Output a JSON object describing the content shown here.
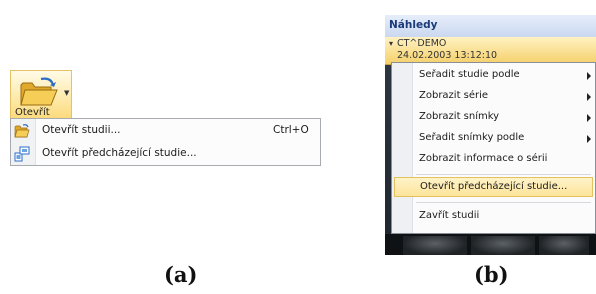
{
  "panel_a": {
    "caption": "(a)",
    "ribbon_button": {
      "label": "Otevřít",
      "icon": "open-folder-icon"
    },
    "menu": [
      {
        "label": "Otevřít studii...",
        "shortcut": "Ctrl+O",
        "icon": "open-folder-icon"
      },
      {
        "label": "Otevřít předcházející studie...",
        "shortcut": "",
        "icon": "previous-studies-icon"
      }
    ]
  },
  "panel_b": {
    "caption": "(b)",
    "window_title": "Náhledy",
    "study": {
      "name": "CT^DEMO",
      "datetime": "24.02.2003 13:12:10"
    },
    "menu": [
      {
        "label": "Seřadit studie podle",
        "submenu": true
      },
      {
        "label": "Zobrazit série",
        "submenu": true
      },
      {
        "label": "Zobrazit snímky",
        "submenu": true
      },
      {
        "label": "Seřadit snímky podle",
        "submenu": true
      },
      {
        "label": "Zobrazit informace o sérii",
        "submenu": false
      },
      {
        "label": "Otevřít předcházející studie...",
        "submenu": false,
        "highlighted": true
      },
      {
        "label": "Zavřít studii",
        "submenu": false
      }
    ],
    "colors": {
      "highlight": "#fde49a",
      "title_text": "#1a3a78",
      "study_header": "#f5d06a"
    }
  }
}
